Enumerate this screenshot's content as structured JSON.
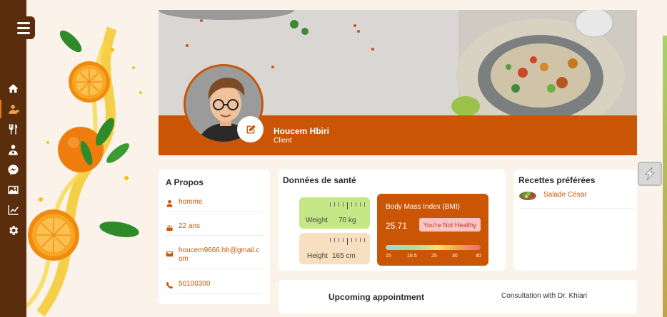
{
  "sidebar": {
    "items": [
      {
        "icon": "home-icon"
      },
      {
        "icon": "profile-icon",
        "active": true
      },
      {
        "icon": "utensils-icon"
      },
      {
        "icon": "doctor-icon"
      },
      {
        "icon": "messenger-icon"
      },
      {
        "icon": "image-icon"
      },
      {
        "icon": "chart-line-icon"
      },
      {
        "icon": "gear-icon"
      }
    ]
  },
  "profile": {
    "name": "Houcem Hbiri",
    "role": "Client"
  },
  "about": {
    "title": "A Propos",
    "gender": "homme",
    "age": "22 ans",
    "email": "houcem9666.hh@gmail.com",
    "phone": "50100300"
  },
  "health": {
    "title": "Données de santé",
    "weight_label": "Weight",
    "weight_value": "70 kg",
    "height_label": "Height",
    "height_value": "165 cm",
    "bmi": {
      "title": "Body Mass Index (BMI)",
      "value": "25.71",
      "status": "You're Not Healthy",
      "scale": [
        "15",
        "18.5",
        "25",
        "30",
        "40"
      ]
    }
  },
  "recipes": {
    "title": "Recettes préférées",
    "items": [
      "Salade César"
    ]
  },
  "appointment": {
    "title": "Upcoming appointment",
    "description": "Consultation with Dr. Khiari"
  },
  "colors": {
    "accent": "#c95505",
    "sidebar": "#5a2e0c",
    "background": "#fbf3ea"
  }
}
